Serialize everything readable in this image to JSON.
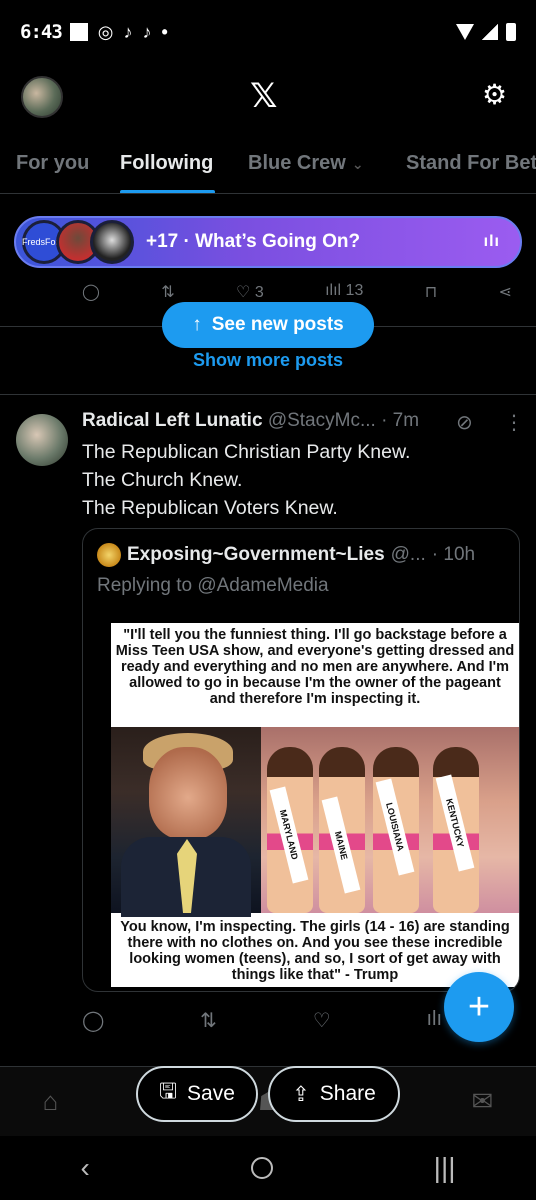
{
  "status_bar": {
    "time": "6:43",
    "icons": [
      "instagram-icon",
      "tiktok-icon",
      "tiktok-icon",
      "dot-icon"
    ],
    "right_icons": [
      "wifi-icon",
      "signal-icon",
      "battery-icon"
    ]
  },
  "top_bar": {
    "logo": "𝕏",
    "settings_icon": "gear-icon"
  },
  "tabs": [
    {
      "label": "For you"
    },
    {
      "label": "Following"
    },
    {
      "label": "Blue Crew"
    },
    {
      "label": "Stand For Bet"
    }
  ],
  "spaces": {
    "text": "+17 · What’s Going On?",
    "host_label": "FredsForm",
    "audio_icon": "ılı"
  },
  "prev_post_actions": {
    "likes": "3",
    "views": "13"
  },
  "feed": {
    "see_new_posts": "See new posts",
    "show_more_posts": "Show more posts"
  },
  "post": {
    "name": "Radical Left Lunatic",
    "handle": "@StacyMc...",
    "time": "· 7m",
    "lines": [
      "The Republican Christian Party Knew.",
      "The Church Knew.",
      "The Republican Voters Knew."
    ],
    "quote": {
      "name": "Exposing~Government~Lies",
      "handle": "@...",
      "time": "· 10h",
      "replying": "Replying to @AdameMedia",
      "meme_top": "\"I'll tell you the funniest thing. I'll go backstage before a Miss Teen USA show, and everyone's getting dressed and ready and everything and no men are anywhere. And I'm allowed to go in because I'm the owner of the pageant and therefore I'm inspecting it.",
      "meme_bottom": "You know, I'm inspecting. The girls (14 - 16) are standing there with no clothes on. And you see these incredible looking women (teens), and so, I sort of get away with things like that\" - Trump",
      "sashes": [
        "MARYLAND",
        "MAINE",
        "LOUISIANA",
        "KENTUCKY"
      ]
    }
  },
  "overlay_buttons": {
    "save": "Save",
    "share": "Share"
  },
  "colors": {
    "accent": "#1d9bf0",
    "background": "#000000",
    "muted": "#71767b",
    "spaces_gradient_start": "#3b55d9",
    "spaces_gradient_end": "#9b5cf0"
  }
}
